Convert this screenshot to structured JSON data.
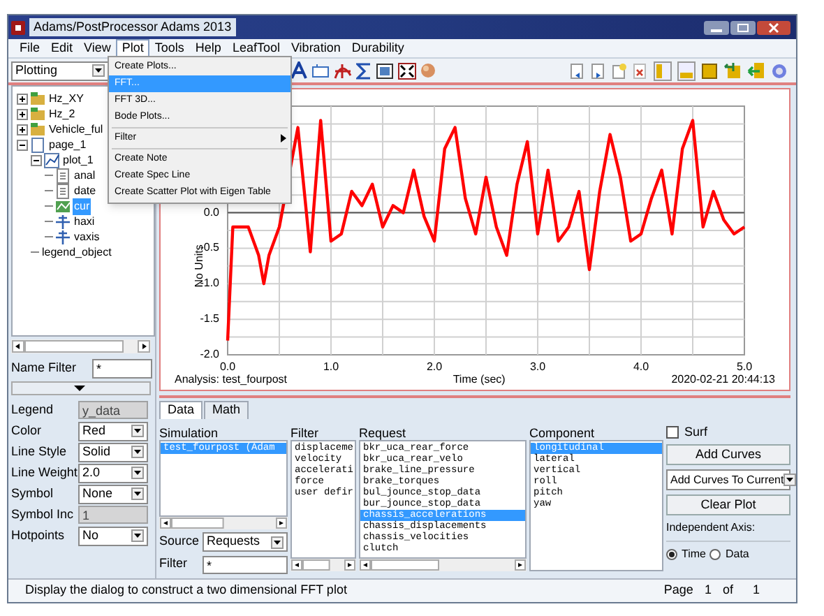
{
  "window": {
    "title": "Adams/PostProcessor Adams 2013"
  },
  "menu_bar": [
    {
      "label": "File",
      "selected": false
    },
    {
      "label": "Edit",
      "selected": false
    },
    {
      "label": "View",
      "selected": false
    },
    {
      "label": "Plot",
      "selected": true
    },
    {
      "label": "Tools",
      "selected": false
    },
    {
      "label": "Help",
      "selected": false
    },
    {
      "label": "LeafTool",
      "selected": false
    },
    {
      "label": "Vibration",
      "selected": false
    },
    {
      "label": "Durability",
      "selected": false
    }
  ],
  "plot_menu": [
    {
      "kind": "item",
      "label": "Create Plots...",
      "selected": false
    },
    {
      "kind": "item",
      "label": "FFT...",
      "selected": true
    },
    {
      "kind": "item",
      "label": "FFT 3D...",
      "selected": false
    },
    {
      "kind": "item",
      "label": "Bode Plots...",
      "selected": false
    },
    {
      "kind": "separator"
    },
    {
      "kind": "submenu",
      "label": "Filter",
      "selected": false
    },
    {
      "kind": "separator"
    },
    {
      "kind": "item",
      "label": "Create Note",
      "selected": false
    },
    {
      "kind": "item",
      "label": "Create Spec Line",
      "selected": false
    },
    {
      "kind": "item",
      "label": "Create Scatter Plot with Eigen Table",
      "selected": false
    }
  ],
  "mode_selector": {
    "value": "Plotting"
  },
  "tree": [
    {
      "kind": "folder",
      "label": "Hz_XY",
      "expanded": false,
      "selected": false
    },
    {
      "kind": "folder",
      "label": "Hz_2",
      "expanded": false,
      "selected": false
    },
    {
      "kind": "folder",
      "label": "Vehicle_ful",
      "expanded": false,
      "selected": false
    },
    {
      "kind": "page",
      "label": "page_1",
      "expanded": true,
      "selected": false,
      "children": [
        {
          "kind": "plot",
          "label": "plot_1",
          "expanded": true,
          "selected": false,
          "children": [
            {
              "kind": "data",
              "label": "anal",
              "selected": false
            },
            {
              "kind": "data",
              "label": "date",
              "selected": false
            },
            {
              "kind": "curve",
              "label": "cur",
              "selected": true
            },
            {
              "kind": "axis",
              "label": "haxi",
              "selected": false
            },
            {
              "kind": "axis",
              "label": "vaxis",
              "selected": false
            }
          ]
        },
        {
          "kind": "legend",
          "label": "legend_object",
          "selected": false
        }
      ]
    }
  ],
  "name_filter": {
    "label": "Name Filter",
    "value": "*"
  },
  "properties": [
    {
      "kind": "text",
      "label": "Legend",
      "value": "y_data",
      "disabled": true
    },
    {
      "kind": "dropdown",
      "label": "Color",
      "value": "Red",
      "disabled": false
    },
    {
      "kind": "dropdown",
      "label": "Line Style",
      "value": "Solid",
      "disabled": false
    },
    {
      "kind": "dropdown",
      "label": "Line Weight",
      "value": "2.0",
      "disabled": false
    },
    {
      "kind": "dropdown",
      "label": "Symbol",
      "value": "None",
      "disabled": false
    },
    {
      "kind": "text",
      "label": "Symbol Inc",
      "value": "1",
      "disabled": true
    },
    {
      "kind": "dropdown",
      "label": "Hotpoints",
      "value": "No",
      "disabled": false
    }
  ],
  "chart": {
    "analysis": "Analysis: test_fourpost",
    "timestamp": "2020-02-21 20:44:13",
    "chart_data": {
      "type": "line",
      "xlabel": "Time (sec)",
      "ylabel": "No Units",
      "x": [
        0,
        0.05,
        0.2,
        0.3,
        0.35,
        0.4,
        0.5,
        0.68,
        0.8,
        0.9,
        1,
        1.1,
        1.2,
        1.3,
        1.4,
        1.5,
        1.6,
        1.7,
        1.8,
        1.9,
        2,
        2.1,
        2.2,
        2.3,
        2.4,
        2.5,
        2.6,
        2.7,
        2.8,
        2.9,
        3,
        3.1,
        3.2,
        3.3,
        3.4,
        3.5,
        3.6,
        3.7,
        3.8,
        3.9,
        4,
        4.1,
        4.2,
        4.3,
        4.4,
        4.5,
        4.6,
        4.7,
        4.8,
        4.9,
        5
      ],
      "grid": true,
      "series": [
        {
          "color": "#ff0000",
          "values": [
            -1.8,
            -0.2,
            -0.2,
            -0.6,
            -1.0,
            -0.6,
            -0.2,
            1.2,
            -0.55,
            1.3,
            -0.4,
            -0.3,
            0.3,
            0.1,
            0.4,
            -0.2,
            0.1,
            0.0,
            0.6,
            -0.05,
            -0.4,
            0.9,
            1.2,
            0.2,
            -0.3,
            0.5,
            -0.2,
            -0.6,
            0.4,
            1.0,
            -0.3,
            0.6,
            -0.4,
            -0.2,
            0.3,
            -0.8,
            0.3,
            1.1,
            0.5,
            -0.4,
            -0.3,
            0.2,
            0.6,
            -0.3,
            0.9,
            1.3,
            -0.2,
            0.3,
            -0.1,
            -0.3,
            -0.2
          ]
        }
      ],
      "xlim": [
        0,
        5
      ],
      "ylim": [
        -2,
        1.5
      ],
      "xticks": [
        {
          "value": 0,
          "label": "0.0"
        },
        {
          "value": 1,
          "label": "1.0"
        },
        {
          "value": 2,
          "label": "2.0"
        },
        {
          "value": 3,
          "label": "3.0"
        },
        {
          "value": 4,
          "label": "4.0"
        },
        {
          "value": 5,
          "label": "5.0"
        }
      ],
      "yticks": [
        {
          "value": -2,
          "label": "-2.0"
        },
        {
          "value": -1.5,
          "label": "-1.5"
        },
        {
          "value": -1,
          "label": "-1.0"
        },
        {
          "value": -0.5,
          "label": "-0.5"
        },
        {
          "value": 0,
          "label": "0.0"
        }
      ]
    }
  },
  "tabs": [
    {
      "label": "Data",
      "selected": true
    },
    {
      "label": "Math",
      "selected": false
    }
  ],
  "simulation": {
    "heading": "Simulation",
    "items": [
      {
        "label": "test_fourpost  (Adam",
        "selected": true
      }
    ]
  },
  "filter_list": {
    "heading": "Filter",
    "items": [
      {
        "label": "displaceme",
        "selected": false
      },
      {
        "label": "velocity",
        "selected": false
      },
      {
        "label": "accelerati",
        "selected": false
      },
      {
        "label": "force",
        "selected": false
      },
      {
        "label": "user defir",
        "selected": false
      }
    ]
  },
  "request": {
    "heading": "Request",
    "items": [
      {
        "label": "bkr_uca_rear_force",
        "selected": false
      },
      {
        "label": "bkr_uca_rear_velo",
        "selected": false
      },
      {
        "label": "brake_line_pressure",
        "selected": false
      },
      {
        "label": "brake_torques",
        "selected": false
      },
      {
        "label": "bul_jounce_stop_data",
        "selected": false
      },
      {
        "label": "bur_jounce_stop_data",
        "selected": false
      },
      {
        "label": "chassis_accelerations",
        "selected": true
      },
      {
        "label": "chassis_displacements",
        "selected": false
      },
      {
        "label": "chassis_velocities",
        "selected": false
      },
      {
        "label": "clutch",
        "selected": false
      }
    ]
  },
  "component": {
    "heading": "Component",
    "items": [
      {
        "label": "longitudinal",
        "selected": true
      },
      {
        "label": "lateral",
        "selected": false
      },
      {
        "label": "vertical",
        "selected": false
      },
      {
        "label": "roll",
        "selected": false
      },
      {
        "label": "pitch",
        "selected": false
      },
      {
        "label": "yaw",
        "selected": false
      }
    ]
  },
  "source": {
    "label": "Source",
    "value": "Requests"
  },
  "filter_field": {
    "label": "Filter",
    "value": "*"
  },
  "surf": {
    "label": "Surf",
    "checked": false
  },
  "add_curves_button": "Add Curves",
  "add_mode": {
    "value": "Add Curves To Current"
  },
  "clear_plot_button": "Clear Plot",
  "independent_axis": {
    "label": "Independent Axis:",
    "options": [
      {
        "label": "Time",
        "selected": true
      },
      {
        "label": "Data",
        "selected": false
      }
    ]
  },
  "status_bar": {
    "message": "Display the dialog to construct a two dimensional FFT plot",
    "page_label": "Page",
    "page": "1",
    "of": "of",
    "total": "1"
  }
}
